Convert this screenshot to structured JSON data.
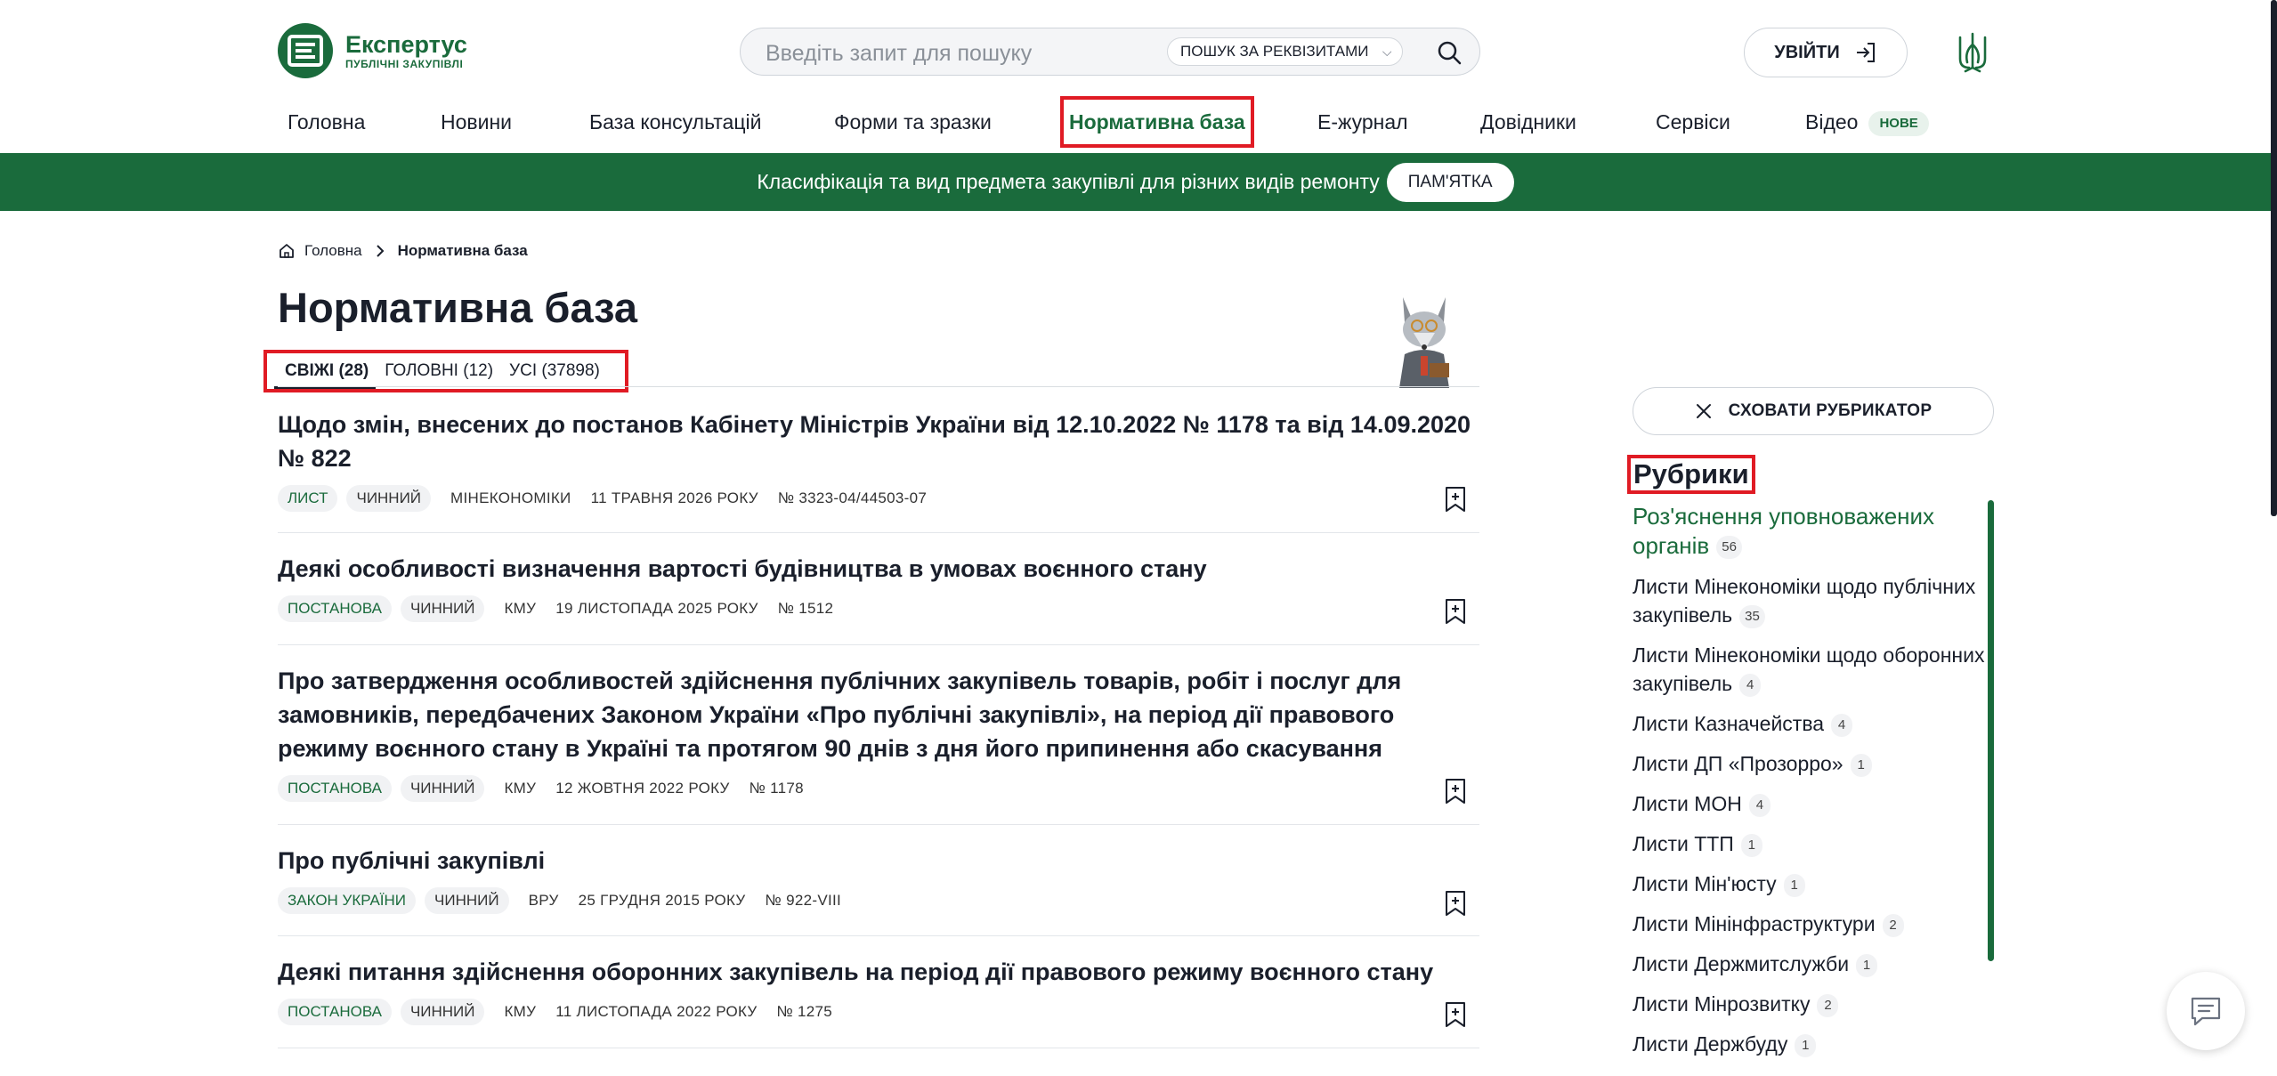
{
  "header": {
    "logo_name": "Експертус",
    "logo_sub": "ПУБЛІЧНІ ЗАКУПІВЛІ",
    "search_placeholder": "Введіть запит для пошуку",
    "search_by_requisites": "ПОШУК ЗА РЕКВІЗИТАМИ",
    "login_label": "УВІЙТИ"
  },
  "nav": {
    "items": [
      "Головна",
      "Новини",
      "База консультацій",
      "Форми та зразки",
      "Нормативна база",
      "Е-журнал",
      "Довідники",
      "Сервіси",
      "Відео"
    ],
    "active_index": 4,
    "new_badge": "НОВЕ"
  },
  "banner": {
    "text": "Класифікація та вид предмета закупівлі для різних видів ремонту",
    "button": "ПАМ'ЯТКА"
  },
  "breadcrumb": {
    "home": "Головна",
    "current": "Нормативна база"
  },
  "page_title": "Нормативна база",
  "tabs": [
    {
      "label": "СВІЖІ (28)",
      "active": true
    },
    {
      "label": "ГОЛОВНІ (12)",
      "active": false
    },
    {
      "label": "УСІ (37898)",
      "active": false
    }
  ],
  "docs": [
    {
      "title": "Щодо змін, внесених до постанов Кабінету Міністрів України від 12.10.2022 № 1178 та від 14.09.2020 № 822",
      "kind": "ЛИСТ",
      "status": "ЧИННИЙ",
      "org": "МІНЕКОНОМІКИ",
      "date": "11 ТРАВНЯ 2026 РОКУ",
      "number": "№ 3323-04/44503-07"
    },
    {
      "title": "Деякі особливості визначення вартості будівництва в умовах воєнного стану",
      "kind": "ПОСТАНОВА",
      "status": "ЧИННИЙ",
      "org": "КМУ",
      "date": "19 ЛИСТОПАДА 2025 РОКУ",
      "number": "№ 1512"
    },
    {
      "title": "Про затвердження особливостей здійснення публічних закупівель товарів, робіт і послуг для замовників, передбачених Законом України «Про публічні закупівлі», на період дії правового режиму воєнного стану в Україні та протягом 90 днів з дня його припинення або скасування",
      "kind": "ПОСТАНОВА",
      "status": "ЧИННИЙ",
      "org": "КМУ",
      "date": "12 ЖОВТНЯ 2022 РОКУ",
      "number": "№ 1178"
    },
    {
      "title": "Про публічні закупівлі",
      "kind": "ЗАКОН УКРАЇНИ",
      "status": "ЧИННИЙ",
      "org": "ВРУ",
      "date": "25 ГРУДНЯ 2015 РОКУ",
      "number": "№ 922-VIII"
    },
    {
      "title": "Деякі питання здійснення оборонних закупівель на період дії правового режиму воєнного стану",
      "kind": "ПОСТАНОВА",
      "status": "ЧИННИЙ",
      "org": "КМУ",
      "date": "11 ЛИСТОПАДА 2022 РОКУ",
      "number": "№ 1275"
    }
  ],
  "sidebar": {
    "hide_label": "СХОВАТИ РУБРИКАТОР",
    "title": "Рубрики",
    "items": [
      {
        "label": "Роз'яснення уповноважених органів",
        "count": "56"
      },
      {
        "label": "Листи Мінекономіки щодо публічних закупівель",
        "count": "35"
      },
      {
        "label": "Листи Мінекономіки щодо оборонних закупівель",
        "count": "4"
      },
      {
        "label": "Листи Казначейства",
        "count": "4"
      },
      {
        "label": "Листи ДП «Прозорро»",
        "count": "1"
      },
      {
        "label": "Листи МОН",
        "count": "4"
      },
      {
        "label": "Листи ТТП",
        "count": "1"
      },
      {
        "label": "Листи Мін'юсту",
        "count": "1"
      },
      {
        "label": "Листи Мінінфраструктури",
        "count": "2"
      },
      {
        "label": "Листи Держмитслужби",
        "count": "1"
      },
      {
        "label": "Листи Мінрозвитку",
        "count": "2"
      },
      {
        "label": "Листи Держбуду",
        "count": "1"
      }
    ]
  },
  "colors": {
    "brand_green": "#1a6b3c",
    "highlight_red": "#e01b24"
  }
}
